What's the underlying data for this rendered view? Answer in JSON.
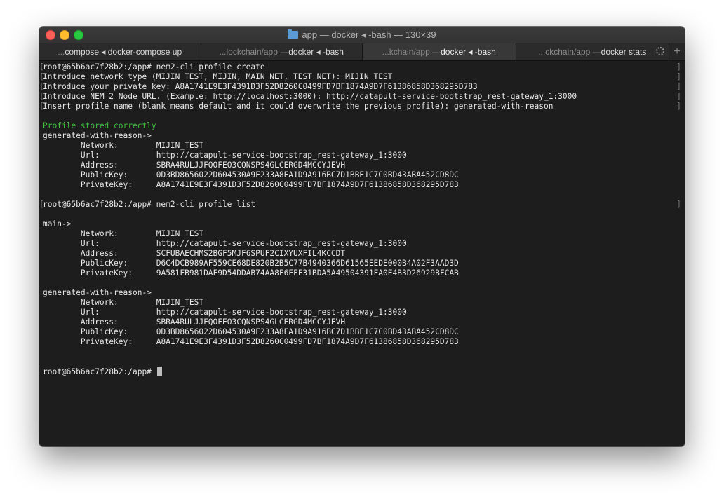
{
  "window": {
    "title": "app — docker ◂ -bash — 130×39"
  },
  "tabs": [
    {
      "dim": "...",
      "bright": "compose ◂ docker-compose up",
      "active": false
    },
    {
      "dim": "...lockchain/app — ",
      "bright": "docker ◂ -bash",
      "active": false
    },
    {
      "dim": "...kchain/app — ",
      "bright": "docker ◂ -bash",
      "active": true
    },
    {
      "dim": "...ckchain/app — ",
      "bright": "docker stats",
      "active": false
    }
  ],
  "terminal": {
    "lines": [
      {
        "text": "root@65b6ac7f28b2:/app# nem2-cli profile create",
        "marked": true
      },
      {
        "text": "Introduce network type (MIJIN_TEST, MIJIN, MAIN_NET, TEST_NET): MIJIN_TEST",
        "marked": true
      },
      {
        "text": "Introduce your private key: A8A1741E9E3F4391D3F52D8260C0499FD7BF1874A9D7F61386858D368295D783",
        "marked": true
      },
      {
        "text": "Introduce NEM 2 Node URL. (Example: http://localhost:3000): http://catapult-service-bootstrap_rest-gateway_1:3000",
        "marked": true
      },
      {
        "text": "Insert profile name (blank means default and it could overwrite the previous profile): generated-with-reason",
        "marked": true
      },
      {
        "text": ""
      },
      {
        "text": "Profile stored correctly",
        "green": true
      },
      {
        "text": "generated-with-reason->"
      },
      {
        "key": "Network:",
        "value": "MIJIN_TEST"
      },
      {
        "key": "Url:",
        "value": "http://catapult-service-bootstrap_rest-gateway_1:3000"
      },
      {
        "key": "Address:",
        "value": "SBRA4RULJJFQOFEO3CQNSPS4GLCERGD4MCCYJEVH"
      },
      {
        "key": "PublicKey:",
        "value": "0D3BD8656022D604530A9F233A8EA1D9A916BC7D1BBE1C7C0BD43ABA452CD8DC"
      },
      {
        "key": "PrivateKey:",
        "value": "A8A1741E9E3F4391D3F52D8260C0499FD7BF1874A9D7F61386858D368295D783"
      },
      {
        "text": ""
      },
      {
        "text": "root@65b6ac7f28b2:/app# nem2-cli profile list",
        "marked": true
      },
      {
        "text": ""
      },
      {
        "text": "main->"
      },
      {
        "key": "Network:",
        "value": "MIJIN_TEST"
      },
      {
        "key": "Url:",
        "value": "http://catapult-service-bootstrap_rest-gateway_1:3000"
      },
      {
        "key": "Address:",
        "value": "SCFUBAECHMS2BGF5MJF6SPUF2CIXYUXFIL4KCCDT"
      },
      {
        "key": "PublicKey:",
        "value": "D6C4DCB989AF559CE68DE820B2B5C77B4940366D61565EEDE000B4A02F3AAD3D"
      },
      {
        "key": "PrivateKey:",
        "value": "9A581FB981DAF9D54DDAB74AA8F6FFF31BDA5A49504391FA0E4B3D26929BFCAB"
      },
      {
        "text": ""
      },
      {
        "text": "generated-with-reason->"
      },
      {
        "key": "Network:",
        "value": "MIJIN_TEST"
      },
      {
        "key": "Url:",
        "value": "http://catapult-service-bootstrap_rest-gateway_1:3000"
      },
      {
        "key": "Address:",
        "value": "SBRA4RULJJFQOFEO3CQNSPS4GLCERGD4MCCYJEVH"
      },
      {
        "key": "PublicKey:",
        "value": "0D3BD8656022D604530A9F233A8EA1D9A916BC7D1BBE1C7C0BD43ABA452CD8DC"
      },
      {
        "key": "PrivateKey:",
        "value": "A8A1741E9E3F4391D3F52D8260C0499FD7BF1874A9D7F61386858D368295D783"
      },
      {
        "text": ""
      },
      {
        "text": ""
      },
      {
        "text": "root@65b6ac7f28b2:/app# ",
        "cursor": true
      }
    ]
  },
  "colors": {
    "success_green": "#3ec33e",
    "terminal_bg": "#1d1d1d",
    "terminal_fg": "#e6e6e6"
  }
}
